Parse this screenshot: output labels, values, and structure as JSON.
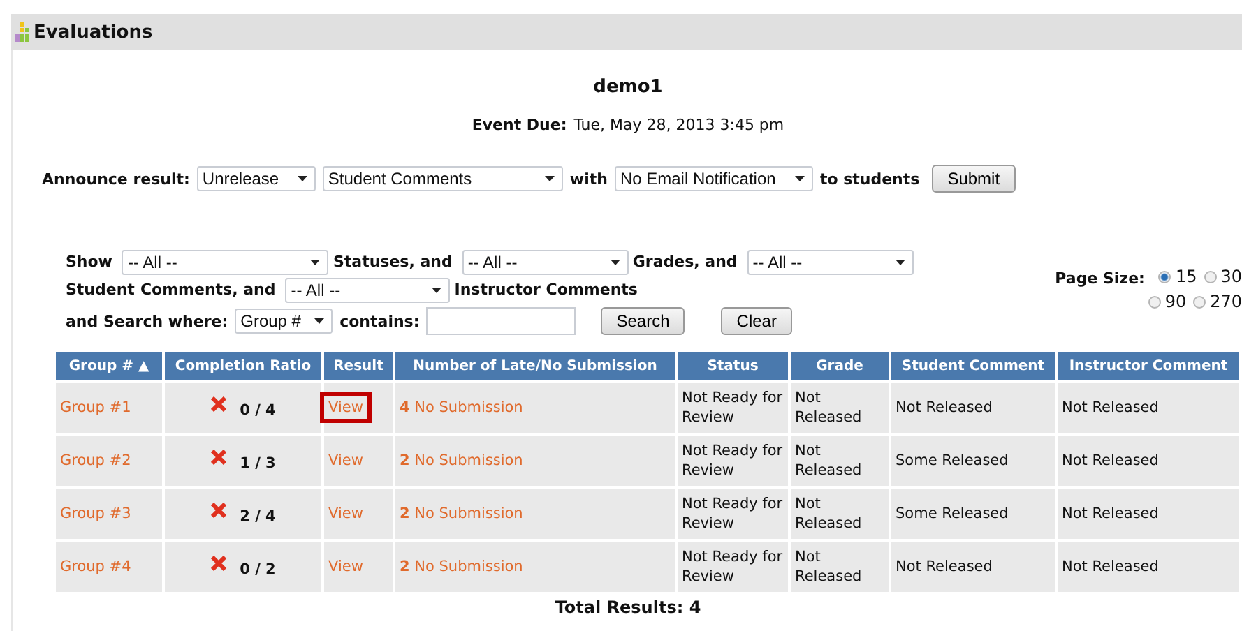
{
  "page": {
    "title": "Evaluations"
  },
  "event": {
    "name": "demo1",
    "due_label": "Event Due:",
    "due": "Tue, May 28, 2013 3:45 pm"
  },
  "announce": {
    "label": "Announce result:",
    "action": "Unrelease",
    "target": "Student Comments",
    "with_label": "with",
    "notification": "No Email Notification",
    "to_label": "to students",
    "submit": "Submit"
  },
  "filters": [
    {
      "kind": "label",
      "text": "Show"
    },
    {
      "kind": "dropdown",
      "value": "-- All --"
    },
    {
      "kind": "label",
      "text": "Statuses, and"
    },
    {
      "kind": "dropdown",
      "value": "-- All --"
    },
    {
      "kind": "label",
      "text": "Grades, and"
    },
    {
      "kind": "dropdown",
      "value": "-- All --"
    },
    {
      "kind": "label",
      "text": "Student"
    },
    {
      "kind": "label",
      "text": "Comments, and"
    },
    {
      "kind": "dropdown",
      "value": "-- All --"
    },
    {
      "kind": "label",
      "text": "Instructor Comments"
    }
  ],
  "page_size": {
    "label": "Page Size:",
    "options": [
      {
        "label": "15",
        "selected": true
      },
      {
        "label": "30",
        "selected": false
      },
      {
        "label": "90",
        "selected": false
      },
      {
        "label": "270",
        "selected": false
      }
    ]
  },
  "search": {
    "label": "and Search where:",
    "field": "Group #",
    "contains_label": "contains:",
    "search_button": "Search",
    "clear_button": "Clear"
  },
  "table": {
    "columns": [
      "Group # ▲",
      "Completion Ratio",
      "Result",
      "Number of Late/No Submission",
      "Status",
      "Grade",
      "Student Comment",
      "Instructor Comment"
    ],
    "rows": [
      {
        "group": "Group #1",
        "complete": false,
        "ratio": "0 / 4",
        "result": "View",
        "highlighted": true,
        "late_count": "4",
        "late_label": "No Submission",
        "status": "Not Ready for Review",
        "grade": "Not Released",
        "student_comment": "Not Released",
        "instructor_comment": "Not Released"
      },
      {
        "group": "Group #2",
        "complete": false,
        "ratio": "1 / 3",
        "result": "View",
        "highlighted": false,
        "late_count": "2",
        "late_label": "No Submission",
        "status": "Not Ready for Review",
        "grade": "Not Released",
        "student_comment": "Some Released",
        "instructor_comment": "Not Released"
      },
      {
        "group": "Group #3",
        "complete": false,
        "ratio": "2 / 4",
        "result": "View",
        "highlighted": false,
        "late_count": "2",
        "late_label": "No Submission",
        "status": "Not Ready for Review",
        "grade": "Not Released",
        "student_comment": "Some Released",
        "instructor_comment": "Not Released"
      },
      {
        "group": "Group #4",
        "complete": false,
        "ratio": "0 / 2",
        "result": "View",
        "highlighted": false,
        "late_count": "2",
        "late_label": "No Submission",
        "status": "Not Ready for Review",
        "grade": "Not Released",
        "student_comment": "Not Released",
        "instructor_comment": "Not Released"
      }
    ]
  },
  "total": "Total Results: 4"
}
